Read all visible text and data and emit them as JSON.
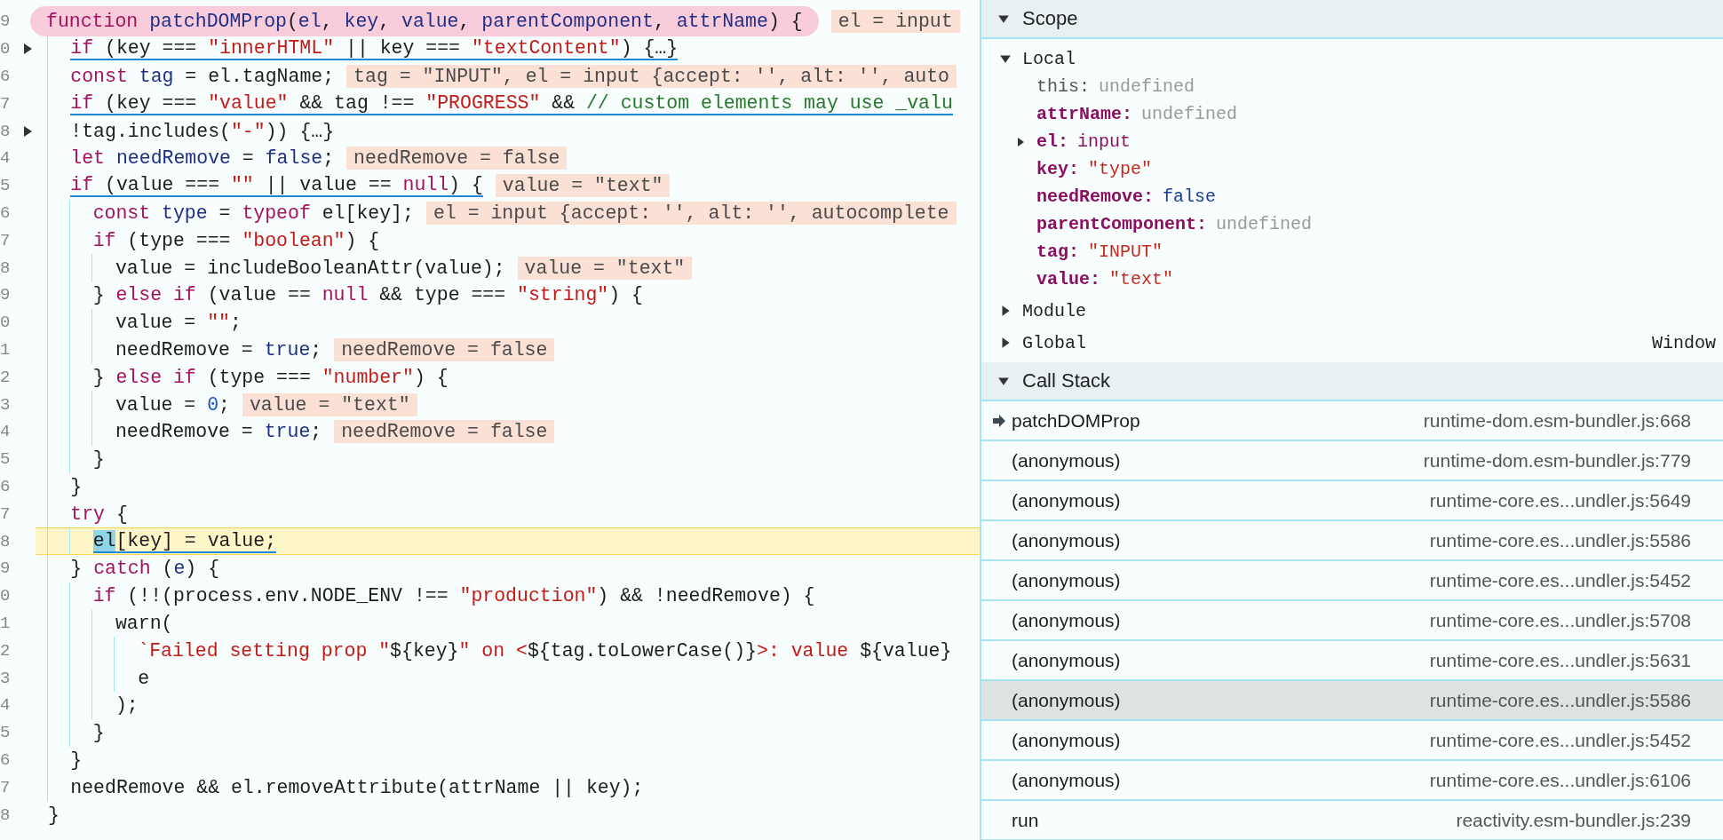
{
  "code": {
    "lines": [
      {
        "number": "9",
        "folded": false,
        "paused": false,
        "underlined": false,
        "circled": true,
        "tokens": [
          {
            "kind": "kw",
            "text": "function "
          },
          {
            "kind": "id",
            "text": "patchDOMProp"
          },
          {
            "kind": "pl",
            "text": "("
          },
          {
            "kind": "id",
            "text": "el"
          },
          {
            "kind": "pl",
            "text": ", "
          },
          {
            "kind": "id",
            "text": "key"
          },
          {
            "kind": "pl",
            "text": ", "
          },
          {
            "kind": "id",
            "text": "value"
          },
          {
            "kind": "pl",
            "text": ", "
          },
          {
            "kind": "id",
            "text": "parentComponent"
          },
          {
            "kind": "pl",
            "text": ", "
          },
          {
            "kind": "id",
            "text": "attrName"
          },
          {
            "kind": "pl",
            "text": ") {"
          }
        ],
        "inline_value": "el = input"
      },
      {
        "number": "0",
        "folded": true,
        "paused": false,
        "underlined": true,
        "circled": false,
        "tokens": [
          {
            "kind": "kw",
            "text": "  if"
          },
          {
            "kind": "pl",
            "text": " (key === "
          },
          {
            "kind": "str",
            "text": "\"innerHTML\""
          },
          {
            "kind": "pl",
            "text": " || key === "
          },
          {
            "kind": "str",
            "text": "\"textContent\""
          },
          {
            "kind": "pl",
            "text": ") {…}"
          }
        ]
      },
      {
        "number": "6",
        "folded": false,
        "paused": false,
        "underlined": false,
        "circled": false,
        "tokens": [
          {
            "kind": "kw",
            "text": "  const "
          },
          {
            "kind": "id",
            "text": "tag"
          },
          {
            "kind": "pl",
            "text": " = el.tagName;"
          }
        ],
        "inline_value": "tag = \"INPUT\", el = input {accept: '', alt: '', auto"
      },
      {
        "number": "7",
        "folded": false,
        "paused": false,
        "underlined": true,
        "circled": false,
        "tokens": [
          {
            "kind": "kw",
            "text": "  if"
          },
          {
            "kind": "pl",
            "text": " (key === "
          },
          {
            "kind": "str",
            "text": "\"value\""
          },
          {
            "kind": "pl",
            "text": " && tag !== "
          },
          {
            "kind": "str",
            "text": "\"PROGRESS\""
          },
          {
            "kind": "pl",
            "text": " && "
          },
          {
            "kind": "cm",
            "text": "// custom elements may use _valu"
          }
        ]
      },
      {
        "number": "8",
        "folded": true,
        "paused": false,
        "underlined": false,
        "circled": false,
        "tokens": [
          {
            "kind": "pl",
            "text": "  !tag.includes("
          },
          {
            "kind": "str",
            "text": "\"-\""
          },
          {
            "kind": "pl",
            "text": ")) {…}"
          }
        ]
      },
      {
        "number": "4",
        "folded": false,
        "paused": false,
        "underlined": false,
        "circled": false,
        "tokens": [
          {
            "kind": "kw",
            "text": "  let "
          },
          {
            "kind": "id",
            "text": "needRemove"
          },
          {
            "kind": "pl",
            "text": " = "
          },
          {
            "kind": "lit",
            "text": "false"
          },
          {
            "kind": "pl",
            "text": ";"
          }
        ],
        "inline_value": "needRemove = false"
      },
      {
        "number": "5",
        "folded": false,
        "paused": false,
        "underlined": true,
        "circled": false,
        "tokens": [
          {
            "kind": "kw",
            "text": "  if"
          },
          {
            "kind": "pl",
            "text": " (value === "
          },
          {
            "kind": "str",
            "text": "\"\""
          },
          {
            "kind": "pl",
            "text": " || value == "
          },
          {
            "kind": "kw",
            "text": "null"
          },
          {
            "kind": "pl",
            "text": ") {"
          }
        ],
        "inline_value": "value = \"text\""
      },
      {
        "number": "6",
        "folded": false,
        "paused": false,
        "underlined": false,
        "circled": false,
        "tokens": [
          {
            "kind": "kw",
            "text": "    const "
          },
          {
            "kind": "id",
            "text": "type"
          },
          {
            "kind": "pl",
            "text": " = "
          },
          {
            "kind": "kw",
            "text": "typeof"
          },
          {
            "kind": "pl",
            "text": " el[key];"
          }
        ],
        "inline_value": "el = input {accept: '', alt: '', autocomplete"
      },
      {
        "number": "7",
        "folded": false,
        "paused": false,
        "underlined": false,
        "circled": false,
        "tokens": [
          {
            "kind": "kw",
            "text": "    if"
          },
          {
            "kind": "pl",
            "text": " (type === "
          },
          {
            "kind": "str",
            "text": "\"boolean\""
          },
          {
            "kind": "pl",
            "text": ") {"
          }
        ]
      },
      {
        "number": "8",
        "folded": false,
        "paused": false,
        "underlined": false,
        "circled": false,
        "tokens": [
          {
            "kind": "pl",
            "text": "      value = includeBooleanAttr(value);"
          }
        ],
        "inline_value": "value = \"text\""
      },
      {
        "number": "9",
        "folded": false,
        "paused": false,
        "underlined": false,
        "circled": false,
        "tokens": [
          {
            "kind": "pl",
            "text": "    } "
          },
          {
            "kind": "kw",
            "text": "else if"
          },
          {
            "kind": "pl",
            "text": " (value == "
          },
          {
            "kind": "kw",
            "text": "null"
          },
          {
            "kind": "pl",
            "text": " && type === "
          },
          {
            "kind": "str",
            "text": "\"string\""
          },
          {
            "kind": "pl",
            "text": ") {"
          }
        ]
      },
      {
        "number": "0",
        "folded": false,
        "paused": false,
        "underlined": false,
        "circled": false,
        "tokens": [
          {
            "kind": "pl",
            "text": "      value = "
          },
          {
            "kind": "str",
            "text": "\"\""
          },
          {
            "kind": "pl",
            "text": ";"
          }
        ]
      },
      {
        "number": "1",
        "folded": false,
        "paused": false,
        "underlined": false,
        "circled": false,
        "tokens": [
          {
            "kind": "pl",
            "text": "      needRemove = "
          },
          {
            "kind": "lit",
            "text": "true"
          },
          {
            "kind": "pl",
            "text": ";"
          }
        ],
        "inline_value": "needRemove = false"
      },
      {
        "number": "2",
        "folded": false,
        "paused": false,
        "underlined": false,
        "circled": false,
        "tokens": [
          {
            "kind": "pl",
            "text": "    } "
          },
          {
            "kind": "kw",
            "text": "else if"
          },
          {
            "kind": "pl",
            "text": " (type === "
          },
          {
            "kind": "str",
            "text": "\"number\""
          },
          {
            "kind": "pl",
            "text": ") {"
          }
        ]
      },
      {
        "number": "3",
        "folded": false,
        "paused": false,
        "underlined": false,
        "circled": false,
        "tokens": [
          {
            "kind": "pl",
            "text": "      value = "
          },
          {
            "kind": "num",
            "text": "0"
          },
          {
            "kind": "pl",
            "text": ";"
          }
        ],
        "inline_value": "value = \"text\""
      },
      {
        "number": "4",
        "folded": false,
        "paused": false,
        "underlined": false,
        "circled": false,
        "tokens": [
          {
            "kind": "pl",
            "text": "      needRemove = "
          },
          {
            "kind": "lit",
            "text": "true"
          },
          {
            "kind": "pl",
            "text": ";"
          }
        ],
        "inline_value": "needRemove = false"
      },
      {
        "number": "5",
        "folded": false,
        "paused": false,
        "underlined": false,
        "circled": false,
        "tokens": [
          {
            "kind": "pl",
            "text": "    }"
          }
        ]
      },
      {
        "number": "6",
        "folded": false,
        "paused": false,
        "underlined": false,
        "circled": false,
        "tokens": [
          {
            "kind": "pl",
            "text": "  }"
          }
        ]
      },
      {
        "number": "7",
        "folded": false,
        "paused": false,
        "underlined": false,
        "circled": false,
        "tokens": [
          {
            "kind": "kw",
            "text": "  try"
          },
          {
            "kind": "pl",
            "text": " {"
          }
        ]
      },
      {
        "number": "8",
        "folded": false,
        "paused": true,
        "underlined": true,
        "circled": false,
        "tokens": [
          {
            "kind": "hl",
            "text": "    el"
          },
          {
            "kind": "pl",
            "text": "[key] = value;"
          }
        ]
      },
      {
        "number": "9",
        "folded": false,
        "paused": false,
        "underlined": false,
        "circled": false,
        "tokens": [
          {
            "kind": "pl",
            "text": "  } "
          },
          {
            "kind": "kw",
            "text": "catch"
          },
          {
            "kind": "pl",
            "text": " ("
          },
          {
            "kind": "id",
            "text": "e"
          },
          {
            "kind": "pl",
            "text": ") {"
          }
        ]
      },
      {
        "number": "0",
        "folded": false,
        "paused": false,
        "underlined": false,
        "circled": false,
        "tokens": [
          {
            "kind": "kw",
            "text": "    if"
          },
          {
            "kind": "pl",
            "text": " (!!(process.env.NODE_ENV !== "
          },
          {
            "kind": "str",
            "text": "\"production\""
          },
          {
            "kind": "pl",
            "text": ") && !needRemove) {"
          }
        ]
      },
      {
        "number": "1",
        "folded": false,
        "paused": false,
        "underlined": false,
        "circled": false,
        "tokens": [
          {
            "kind": "pl",
            "text": "      warn("
          }
        ]
      },
      {
        "number": "2",
        "folded": false,
        "paused": false,
        "underlined": false,
        "circled": false,
        "tokens": [
          {
            "kind": "str",
            "text": "        `Failed setting prop \""
          },
          {
            "kind": "pl",
            "text": "${key}"
          },
          {
            "kind": "str",
            "text": "\" on <"
          },
          {
            "kind": "pl",
            "text": "${tag.toLowerCase()}"
          },
          {
            "kind": "str",
            "text": ">: value "
          },
          {
            "kind": "pl",
            "text": "${value}"
          }
        ]
      },
      {
        "number": "3",
        "folded": false,
        "paused": false,
        "underlined": false,
        "circled": false,
        "tokens": [
          {
            "kind": "pl",
            "text": "        e"
          }
        ]
      },
      {
        "number": "4",
        "folded": false,
        "paused": false,
        "underlined": false,
        "circled": false,
        "tokens": [
          {
            "kind": "pl",
            "text": "      );"
          }
        ]
      },
      {
        "number": "5",
        "folded": false,
        "paused": false,
        "underlined": false,
        "circled": false,
        "tokens": [
          {
            "kind": "pl",
            "text": "    }"
          }
        ]
      },
      {
        "number": "6",
        "folded": false,
        "paused": false,
        "underlined": false,
        "circled": false,
        "tokens": [
          {
            "kind": "pl",
            "text": "  }"
          }
        ]
      },
      {
        "number": "7",
        "folded": false,
        "paused": false,
        "underlined": false,
        "circled": false,
        "tokens": [
          {
            "kind": "pl",
            "text": "  needRemove && el.removeAttribute(attrName || key);"
          }
        ]
      },
      {
        "number": "8",
        "folded": false,
        "paused": false,
        "underlined": false,
        "circled": false,
        "tokens": [
          {
            "kind": "pl",
            "text": "}"
          }
        ]
      }
    ]
  },
  "scope": {
    "title": "Scope",
    "expanded": true,
    "local": {
      "label": "Local",
      "expanded": true,
      "variables": [
        {
          "name": "this:",
          "value": "undefined",
          "kind": "undefined",
          "internal": true,
          "expandable": false
        },
        {
          "name": "attrName:",
          "value": "undefined",
          "kind": "undefined",
          "internal": false,
          "expandable": false
        },
        {
          "name": "el:",
          "value": "input",
          "kind": "object",
          "internal": false,
          "expandable": true,
          "expanded": false
        },
        {
          "name": "key:",
          "value": "\"type\"",
          "kind": "string",
          "internal": false,
          "expandable": false
        },
        {
          "name": "needRemove:",
          "value": "false",
          "kind": "boolean",
          "internal": false,
          "expandable": false
        },
        {
          "name": "parentComponent:",
          "value": "undefined",
          "kind": "undefined",
          "internal": false,
          "expandable": false
        },
        {
          "name": "tag:",
          "value": "\"INPUT\"",
          "kind": "string",
          "internal": false,
          "expandable": false
        },
        {
          "name": "value:",
          "value": "\"text\"",
          "kind": "string",
          "internal": false,
          "expandable": false
        }
      ]
    },
    "others": [
      {
        "label": "Module",
        "expanded": false
      },
      {
        "label": "Global",
        "expanded": false,
        "value": "Window"
      }
    ]
  },
  "call_stack": {
    "title": "Call Stack",
    "expanded": true,
    "frames": [
      {
        "name": "patchDOMProp",
        "location": "runtime-dom.esm-bundler.js:668",
        "kind": "current",
        "selected": false
      },
      {
        "name": "(anonymous)",
        "location": "runtime-dom.esm-bundler.js:779",
        "kind": "caller",
        "selected": false
      },
      {
        "name": "(anonymous)",
        "location": "runtime-core.es...undler.js:5649",
        "kind": "caller",
        "selected": false
      },
      {
        "name": "(anonymous)",
        "location": "runtime-core.es...undler.js:5586",
        "kind": "caller",
        "selected": false
      },
      {
        "name": "(anonymous)",
        "location": "runtime-core.es...undler.js:5452",
        "kind": "caller",
        "selected": false
      },
      {
        "name": "(anonymous)",
        "location": "runtime-core.es...undler.js:5708",
        "kind": "caller",
        "selected": false
      },
      {
        "name": "(anonymous)",
        "location": "runtime-core.es...undler.js:5631",
        "kind": "caller",
        "selected": false
      },
      {
        "name": "(anonymous)",
        "location": "runtime-core.es...undler.js:5586",
        "kind": "caller",
        "selected": true
      },
      {
        "name": "(anonymous)",
        "location": "runtime-core.es...undler.js:5452",
        "kind": "caller",
        "selected": false
      },
      {
        "name": "(anonymous)",
        "location": "runtime-core.es...undler.js:6106",
        "kind": "caller",
        "selected": false
      },
      {
        "name": "run",
        "location": "reactivity.esm-bundler.js:239",
        "kind": "caller",
        "selected": false
      }
    ]
  }
}
